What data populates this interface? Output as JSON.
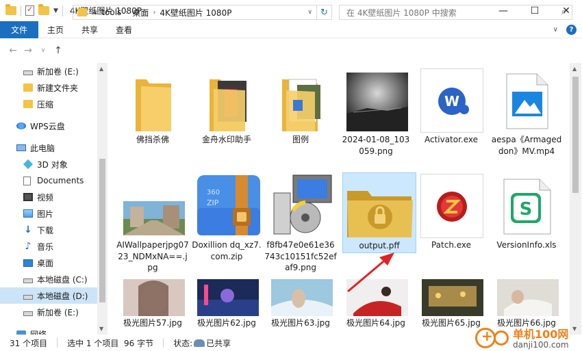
{
  "window": {
    "title": "4K壁纸图片 1080P",
    "minimize": "—",
    "maximize": "☐",
    "close": "✕"
  },
  "ribbon": {
    "file": "文件",
    "tabs": [
      "主页",
      "共享",
      "查看"
    ],
    "help": "?"
  },
  "address": {
    "prefix": "«",
    "crumbs": [
      "tools",
      "桌面",
      "4K壁纸图片 1080P"
    ],
    "search_placeholder": "在 4K壁纸图片 1080P 中搜索"
  },
  "nav": {
    "items": [
      {
        "label": "新加卷 (E:)",
        "icon": "drive-icon"
      },
      {
        "label": "新建文件夹",
        "icon": "folder-icon"
      },
      {
        "label": "压缩",
        "icon": "folder-icon"
      },
      {
        "label": "WPS云盘",
        "icon": "wps-cloud-icon"
      },
      {
        "label": "此电脑",
        "icon": "pc-icon"
      },
      {
        "label": "3D 对象",
        "icon": "3d-objects-icon"
      },
      {
        "label": "Documents",
        "icon": "document-icon"
      },
      {
        "label": "视频",
        "icon": "video-icon"
      },
      {
        "label": "图片",
        "icon": "pictures-icon"
      },
      {
        "label": "下载",
        "icon": "download-icon"
      },
      {
        "label": "音乐",
        "icon": "music-icon"
      },
      {
        "label": "桌面",
        "icon": "desktop-icon"
      },
      {
        "label": "本地磁盘 (C:)",
        "icon": "drive-icon"
      },
      {
        "label": "本地磁盘 (D:)",
        "icon": "drive-icon"
      },
      {
        "label": "新加卷 (E:)",
        "icon": "drive-icon"
      },
      {
        "label": "网络",
        "icon": "network-icon"
      }
    ],
    "selected_index": 13
  },
  "files": {
    "row1": [
      {
        "name": "佛挡杀佛",
        "type": "folder"
      },
      {
        "name": "金舟水印助手",
        "type": "folder"
      },
      {
        "name": "图例",
        "type": "folder"
      },
      {
        "name": "2024-01-08_103059.png",
        "type": "image"
      },
      {
        "name": "Activator.exe",
        "type": "exe"
      },
      {
        "name": "aespa《Armageddon》MV.mp4",
        "type": "video"
      }
    ],
    "row2": [
      {
        "name": "AIWallpaperjpg0723_NDMxNA==.jpg",
        "type": "image"
      },
      {
        "name": "Doxillion dq_xz7.com.zip",
        "type": "zip"
      },
      {
        "name": "f8fb47e0e61e36743c10151fc52efaf9.png",
        "type": "image"
      },
      {
        "name": "output.pff",
        "type": "locked-folder"
      },
      {
        "name": "Patch.exe",
        "type": "exe"
      },
      {
        "name": "VersionInfo.xls",
        "type": "xls"
      }
    ],
    "row3": [
      {
        "name": "极光图片57.jpg",
        "type": "image"
      },
      {
        "name": "极光图片62.jpg",
        "type": "image"
      },
      {
        "name": "极光图片63.jpg",
        "type": "image"
      },
      {
        "name": "极光图片64.jpg",
        "type": "image"
      },
      {
        "name": "极光图片65.jpg",
        "type": "image"
      },
      {
        "name": "极光图片66.jpg",
        "type": "image"
      }
    ],
    "selected": "output.pff"
  },
  "status": {
    "count": "31 个项目",
    "selection": "选中 1 个项目  96 字节",
    "state_label": "状态:",
    "state_value": "已共享"
  },
  "watermark": {
    "title": "单机100网",
    "subtitle": "danji100.com"
  },
  "colors": {
    "accent": "#1a6fc0",
    "selection": "#cce8ff",
    "folder": "#f4c343",
    "arrow": "#e02424"
  }
}
